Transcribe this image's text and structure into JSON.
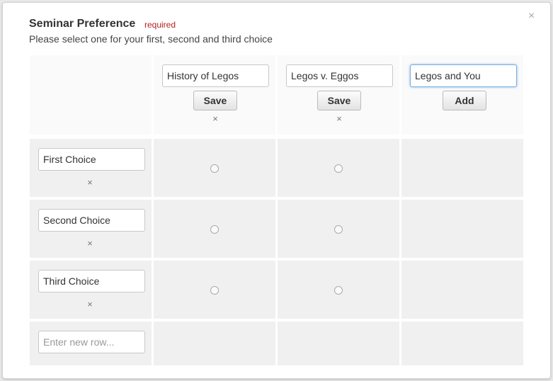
{
  "dialog": {
    "title": "Seminar Preference",
    "required_label": "required",
    "instructions": "Please select one for your first, second and third choice",
    "close_glyph": "×"
  },
  "columns": [
    {
      "label": "History of Legos",
      "button_label": "Save",
      "remove_glyph": "×"
    },
    {
      "label": "Legos v. Eggos",
      "button_label": "Save",
      "remove_glyph": "×"
    },
    {
      "label": "Legos and You",
      "button_label": "Add"
    }
  ],
  "rows": [
    {
      "label": "First Choice",
      "remove_glyph": "×"
    },
    {
      "label": "Second Choice",
      "remove_glyph": "×"
    },
    {
      "label": "Third Choice",
      "remove_glyph": "×"
    }
  ],
  "new_row": {
    "placeholder": "Enter new row..."
  },
  "colors": {
    "required": "#b22222",
    "focus": "#7ab0e0",
    "cell_bg": "#f0f0f0"
  }
}
